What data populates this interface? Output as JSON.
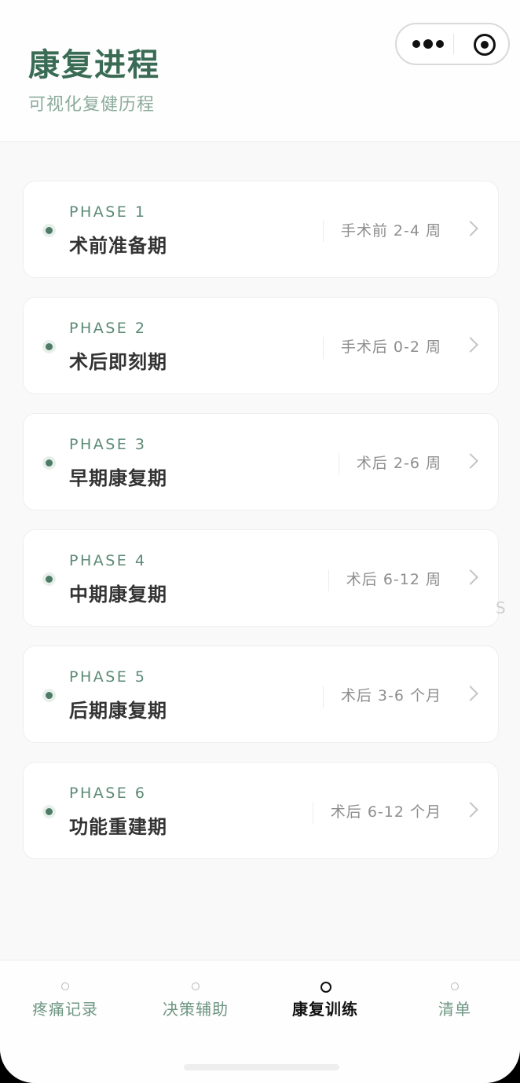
{
  "header": {
    "title": "康复进程",
    "subtitle": "可视化复健历程"
  },
  "capsule": {
    "menu_icon": "more-dots-icon",
    "close_icon": "target-icon"
  },
  "phases": [
    {
      "phase": "PHASE 1",
      "name": "术前准备期",
      "range": "手术前 2-4 周"
    },
    {
      "phase": "PHASE 2",
      "name": "术后即刻期",
      "range": "手术后 0-2 周"
    },
    {
      "phase": "PHASE 3",
      "name": "早期康复期",
      "range": "术后 2-6 周"
    },
    {
      "phase": "PHASE 4",
      "name": "中期康复期",
      "range": "术后 6-12 周"
    },
    {
      "phase": "PHASE 5",
      "name": "后期康复期",
      "range": "术后 3-6 个月"
    },
    {
      "phase": "PHASE 6",
      "name": "功能重建期",
      "range": "术后 6-12 个月"
    }
  ],
  "stray_text": "S",
  "tabs": [
    {
      "label": "疼痛记录",
      "active": false
    },
    {
      "label": "决策辅助",
      "active": false
    },
    {
      "label": "康复训练",
      "active": true
    },
    {
      "label": "清单",
      "active": false
    }
  ],
  "colors": {
    "accent": "#3a6c55",
    "phase_label": "#5b8a75",
    "tab_inactive": "#6f9683",
    "tab_active": "#111111"
  }
}
